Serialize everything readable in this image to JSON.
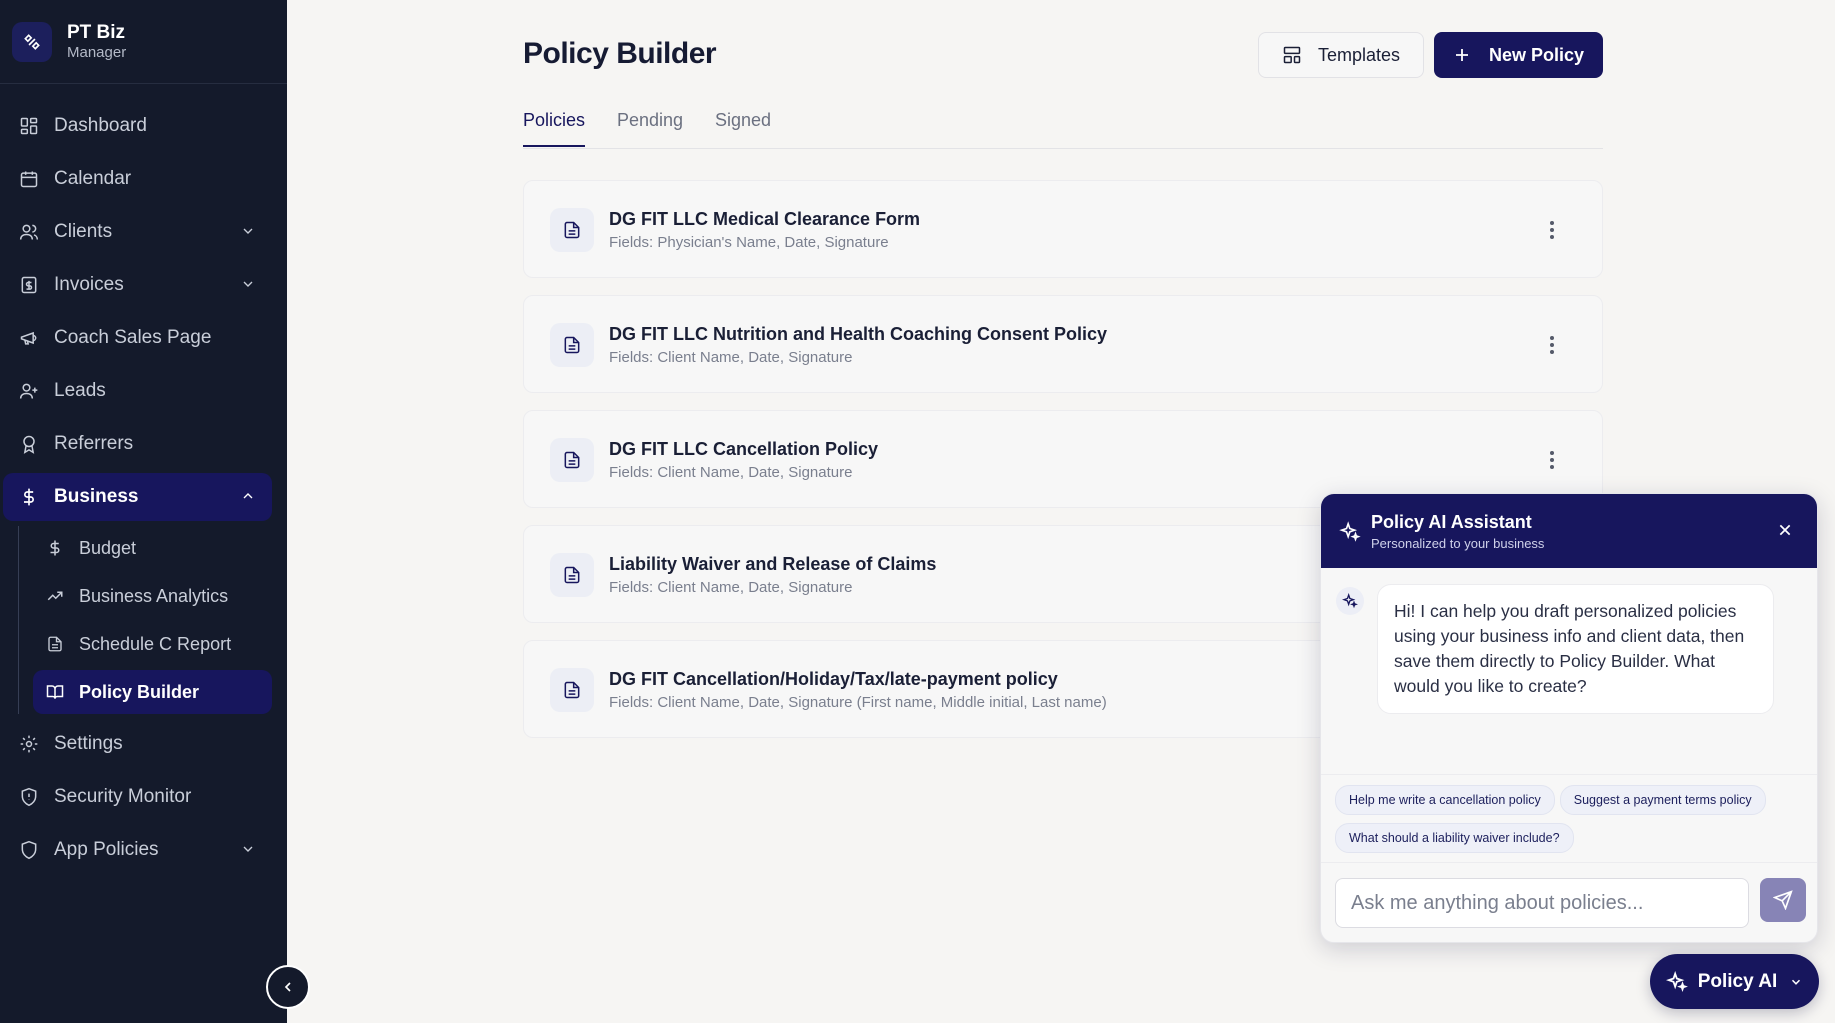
{
  "brand": {
    "name": "PT Biz",
    "role": "Manager",
    "logo_icon": "brand-logo-icon"
  },
  "sidebar": {
    "items": [
      {
        "label": "Dashboard",
        "icon": "dashboard-icon"
      },
      {
        "label": "Calendar",
        "icon": "calendar-icon"
      },
      {
        "label": "Clients",
        "icon": "users-icon",
        "expandable": true
      },
      {
        "label": "Invoices",
        "icon": "invoice-icon",
        "expandable": true
      },
      {
        "label": "Coach Sales Page",
        "icon": "megaphone-icon"
      },
      {
        "label": "Leads",
        "icon": "user-plus-icon"
      },
      {
        "label": "Referrers",
        "icon": "award-icon"
      },
      {
        "label": "Business",
        "icon": "dollar-icon",
        "expanded": true,
        "active": true
      },
      {
        "label": "Settings",
        "icon": "gear-icon"
      },
      {
        "label": "Security Monitor",
        "icon": "shield-icon"
      },
      {
        "label": "App Policies",
        "icon": "shield-icon",
        "expandable": true
      }
    ],
    "business_sub": [
      {
        "label": "Budget",
        "icon": "dollar-icon"
      },
      {
        "label": "Business Analytics",
        "icon": "trend-up-icon"
      },
      {
        "label": "Schedule C Report",
        "icon": "document-icon"
      },
      {
        "label": "Policy Builder",
        "icon": "book-open-icon",
        "active": true
      }
    ]
  },
  "header": {
    "title": "Policy Builder",
    "templates_label": "Templates",
    "new_policy_label": "New Policy"
  },
  "tabs": [
    {
      "label": "Policies",
      "active": true
    },
    {
      "label": "Pending"
    },
    {
      "label": "Signed"
    }
  ],
  "policies": [
    {
      "title": "DG FIT LLC Medical Clearance Form",
      "fields": "Fields: Physician's Name, Date, Signature"
    },
    {
      "title": "DG FIT LLC Nutrition and Health Coaching Consent Policy",
      "fields": "Fields: Client Name, Date, Signature"
    },
    {
      "title": "DG FIT LLC Cancellation Policy",
      "fields": "Fields: Client Name, Date, Signature"
    },
    {
      "title": "Liability Waiver and Release of Claims",
      "fields": "Fields: Client Name, Date, Signature"
    },
    {
      "title": "DG FIT Cancellation/Holiday/Tax/late-payment policy",
      "fields": "Fields: Client Name, Date, Signature (First name, Middle initial, Last name)"
    }
  ],
  "chat": {
    "title": "Policy AI Assistant",
    "subtitle": "Personalized to your business",
    "greeting": "Hi! I can help you draft personalized policies using your business info and client data, then save them directly to Policy Builder. What would you like to create?",
    "suggestions": [
      "Help me write a cancellation policy",
      "Suggest a payment terms policy",
      "What should a liability waiver include?"
    ],
    "input_value": "",
    "input_placeholder": "Ask me anything about policies..."
  },
  "fab": {
    "label": "Policy AI"
  },
  "colors": {
    "sidebar_bg": "#141a2b",
    "accent": "#17165d",
    "page_bg": "#f6f5f3",
    "send_button": "#8784b6"
  }
}
